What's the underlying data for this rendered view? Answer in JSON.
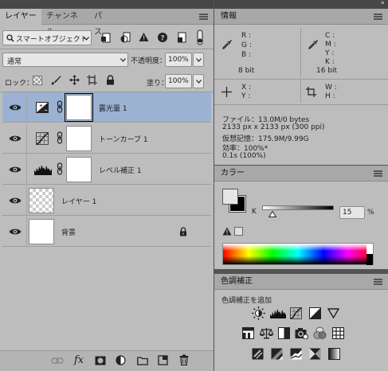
{
  "layers_panel": {
    "tabs": [
      {
        "label": "レイヤー",
        "active": true
      },
      {
        "label": "チャンネル",
        "active": false
      },
      {
        "label": "パス",
        "active": false
      }
    ],
    "filter_kind": "スマートオブジェクト",
    "blend_mode": "通常",
    "opacity_label": "不透明度：",
    "opacity_value": "100%",
    "lock_label": "ロック：",
    "fill_label": "塗り：",
    "fill_value": "100%",
    "layers": [
      {
        "name": "露光量 1",
        "type": "adjustment",
        "icon": "exposure-icon",
        "selected": true,
        "linked_mask": true
      },
      {
        "name": "トーンカーブ 1",
        "type": "adjustment",
        "icon": "curves-icon",
        "selected": false,
        "linked_mask": true
      },
      {
        "name": "レベル補正 1",
        "type": "adjustment",
        "icon": "levels-icon",
        "selected": false,
        "linked_mask": true
      },
      {
        "name": "レイヤー 1",
        "type": "pixel",
        "icon": "transparent-thumbnail",
        "selected": false
      },
      {
        "name": "背景",
        "type": "background",
        "icon": "white-thumbnail",
        "selected": false,
        "locked": true
      }
    ],
    "bottom_icons": [
      "link-icon",
      "fx-icon",
      "mask-icon",
      "adjustment-layer-icon",
      "folder-icon",
      "new-layer-icon",
      "trash-icon"
    ],
    "fx_label": "fx"
  },
  "info_panel": {
    "title": "情報",
    "rgb_labels": [
      "R :",
      "G :",
      "B :"
    ],
    "cmyk_labels": [
      "C :",
      "M :",
      "Y :",
      "K :"
    ],
    "left_bit": "8 bit",
    "right_bit": "16 bit",
    "xy_labels": [
      "X :",
      "Y :"
    ],
    "wh_labels": [
      "W :",
      "H :"
    ],
    "details": [
      "ファイル：13.0M/0 bytes",
      "2133 px x 2133 px (300 ppi)",
      "仮想記憶：175.9M/9.99G",
      "効率：100%*",
      "0.1s (100%)"
    ]
  },
  "color_panel": {
    "title": "カラー",
    "channel_label": "K",
    "value": "15",
    "unit": "%",
    "foreground_color": "#e6e6e6",
    "background_color": "#000000"
  },
  "adjustments_panel": {
    "title": "色調補正",
    "subtitle": "色調補正を追加",
    "row1": [
      "brightness-contrast-icon",
      "levels-icon",
      "curves-icon",
      "exposure-icon",
      "vibrance-icon"
    ],
    "row2": [
      "hue-saturation-icon",
      "color-balance-icon",
      "black-white-icon",
      "photo-filter-icon",
      "channel-mixer-icon",
      "color-lookup-icon"
    ],
    "row3": [
      "invert-icon",
      "posterize-icon",
      "threshold-icon",
      "selective-color-icon",
      "gradient-map-icon"
    ]
  },
  "colors": {
    "selection": "#9bb2d3",
    "panel_bg": "#bdbdbd",
    "tab_bar": "#a8a8a8"
  }
}
